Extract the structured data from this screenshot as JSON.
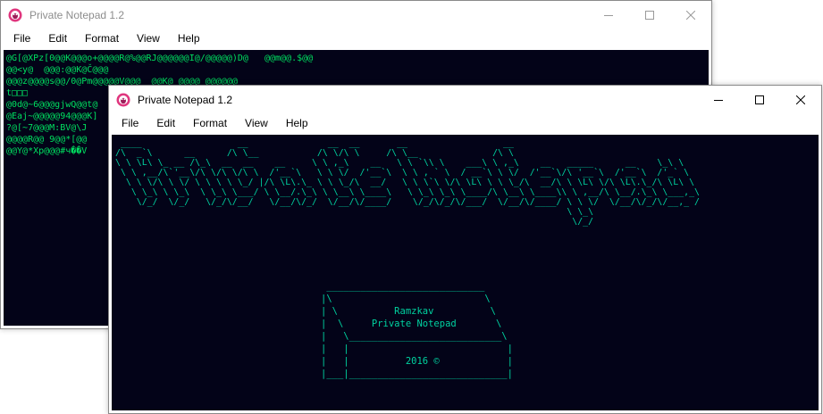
{
  "back_window": {
    "title": "Private Notepad 1.2",
    "menu": [
      "File",
      "Edit",
      "Format",
      "View",
      "Help"
    ],
    "content": "@G[@XPz[0@@K@@@o+@@@@R@%@@RJ@@@@@@I@/@@@@@)D@   @@m@@.$@@\n@@<y@  @@@:@@K@Č@@@\n@@@z@@@@s@@/0@Pm@@@@@V@@@  @@K@ @@@@ @@@@@@\nt□□□\n@0d@~6@@@gjwQ@@t@\n@Eaj~@@@@@94@@@K]\n?@[~7@@@M:BV@\\J\n@@@@R@@ 9@@*[@@\n@@Y@*Xp@@@#ч��V"
  },
  "front_window": {
    "title": "Private Notepad 1.2",
    "menu": [
      "File",
      "Edit",
      "Format",
      "View",
      "Help"
    ],
    "banner": " ____                  __               __  __       __                  __\n/\\  _`\\      __      /\\ \\__           /\\ \\/\\ \\     /\\ \\__              /\\ \\\n\\ \\ \\L\\ \\_ __ /\\_\\  __  __    __     \\ \\ ,_\\    __   \\ \\ `\\\\ \\    ___\\ \\ ,_\\    __   _____      __    \\_\\ \\\n \\ \\ ,__/\\`'__\\/\\ \\/\\ \\/\\ \\  /'__`\\   \\ \\ \\/  /'__`\\  \\ \\ , ` \\  / __`\\ \\ \\/  /'__`\\/\\ '__`\\  /'__`\\  /'_` \\\n  \\ \\ \\/\\ \\ \\/ \\ \\ \\ \\ \\_/ |/\\ \\L\\.\\_ \\ \\ \\_/\\  __/   \\ \\ \\`\\ \\/\\ \\L\\ \\ \\ \\_/\\  __/\\ \\ \\L\\ \\/\\ \\L\\.\\_/\\ \\L\\ \\\n   \\ \\_\\ \\ \\_\\  \\ \\_\\ \\___/ \\ \\__/.\\_\\ \\ \\__\\ \\____\\   \\ \\_\\ \\_\\ \\____/\\ \\__\\ \\____\\\\ \\ ,__/\\ \\__/.\\_\\ \\___,_\\\n    \\/_/  \\/_/   \\/_/\\/__/   \\/__/\\/_/  \\/__/\\/____/    \\/_/\\/_/\\/___/  \\/__/\\/____/ \\ \\ \\/  \\/__/\\/_/\\/__,_ /\n                                                                                     \\ \\_\\\n                                                                                      \\/_/",
    "box": " ____________________________\n|\\                           \\\n| \\          Ramzkav          \\\n|  \\     Private Notepad       \\\n|   \\___________________________\\\n|   |                            |\n|   |          2016 ©            |\n|___|____________________________|"
  }
}
